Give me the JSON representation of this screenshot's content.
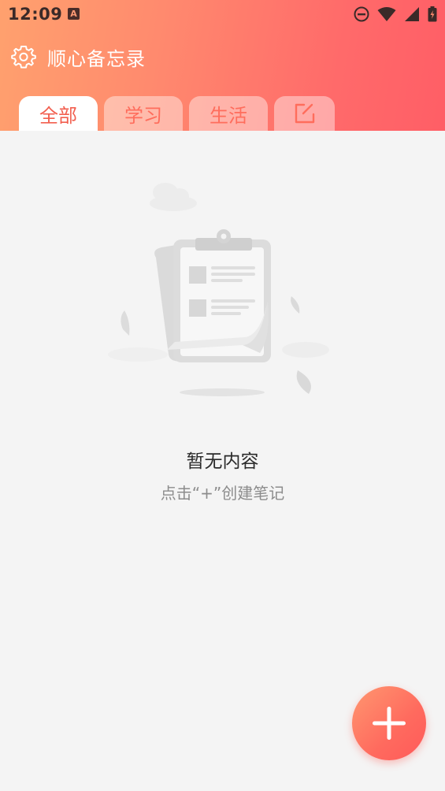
{
  "status_bar": {
    "time": "12:09",
    "notification_icon": "A"
  },
  "header": {
    "settings_icon": "gear-icon",
    "app_title": "顺心备忘录"
  },
  "tabs": [
    {
      "label": "全部",
      "active": true
    },
    {
      "label": "学习",
      "active": false
    },
    {
      "label": "生活",
      "active": false
    }
  ],
  "edit_tab_icon": "edit-icon",
  "empty_state": {
    "title": "暂无内容",
    "subtitle": "点击“+”创建笔记"
  },
  "fab": {
    "icon": "plus-icon"
  },
  "colors": {
    "header_gradient_start": "#ffa16e",
    "header_gradient_end": "#ff5e66",
    "accent": "#f25f4f",
    "background": "#f4f4f4"
  }
}
